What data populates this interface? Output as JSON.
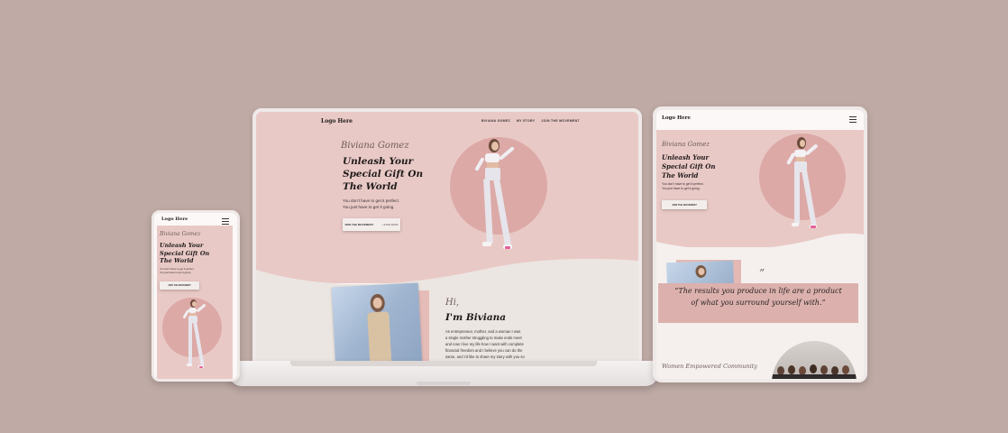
{
  "colors": {
    "background": "#bfaaa5",
    "hero_pink": "#e9c9c6",
    "circle_pink": "#dca9a6",
    "cream": "#ece6e2",
    "accent_shoe": "#e55f9a"
  },
  "laptop": {
    "logo": "Logo Here",
    "nav": [
      "BIVIANA GOMEZ",
      "MY STORY",
      "JOIN THE MOVEMENT"
    ],
    "signature": "Biviana Gomez",
    "headline": [
      "Unleash Your",
      "Special Gift On",
      "The World"
    ],
    "subtext": [
      "You don't have to get it perfect.",
      "You just have to get it going."
    ],
    "button_label": "JOIN THE MOVEMENT",
    "button_secondary": "LEARN MORE",
    "about_greeting": "Hi,",
    "about_title": "I'm Biviana",
    "about_text": [
      "As entrepreneur, mother, and a woman I was",
      "a single mother struggling to make ends meet",
      "and now I live my life how I want with complete",
      "financial freedom and I believe you can do the",
      "same, and I'd like to share my story with you so",
      "you know that it's possible."
    ]
  },
  "phone": {
    "logo": "Logo Here",
    "signature": "Biviana Gomez",
    "headline": [
      "Unleash Your",
      "Special Gift On",
      "The World"
    ],
    "subtext": [
      "You don't have to get it perfect.",
      "You just have to get it going."
    ],
    "button_label": "JOIN THE MOVEMENT"
  },
  "tablet": {
    "logo": "Logo Here",
    "signature": "Biviana Gomez",
    "headline": [
      "Unleash Your",
      "Special Gift On",
      "The World"
    ],
    "subtext": [
      "You don't have to get it perfect.",
      "You just have to get it going."
    ],
    "button_label": "JOIN THE MOVEMENT",
    "quote_mark": "”",
    "quote": [
      "“The results you produce in life are a product",
      "of what you surround yourself with.”"
    ],
    "footer_script": "Women Empowered Community"
  }
}
